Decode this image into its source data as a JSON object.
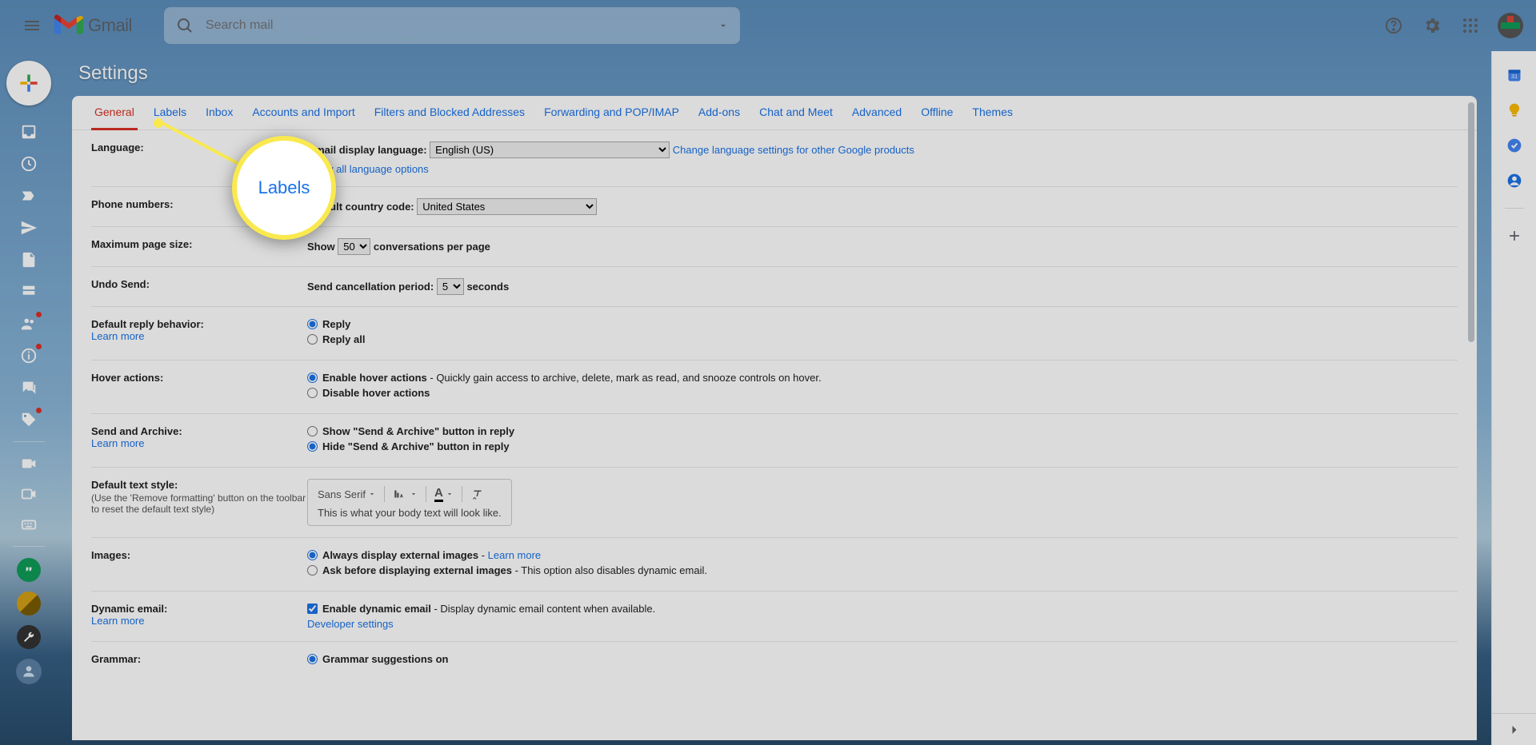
{
  "app": {
    "name": "Gmail"
  },
  "search": {
    "placeholder": "Search mail"
  },
  "page_title": "Settings",
  "tabs": [
    "General",
    "Labels",
    "Inbox",
    "Accounts and Import",
    "Filters and Blocked Addresses",
    "Forwarding and POP/IMAP",
    "Add-ons",
    "Chat and Meet",
    "Advanced",
    "Offline",
    "Themes"
  ],
  "active_tab": "General",
  "callout_label": "Labels",
  "settings": {
    "language": {
      "label": "Language:",
      "field_label": "Gmail display language:",
      "selected": "English (US)",
      "change_link": "Change language settings for other Google products",
      "show_all": "Show all language options"
    },
    "phone": {
      "label": "Phone numbers:",
      "field_label": "Default country code:",
      "selected": "United States"
    },
    "page_size": {
      "label": "Maximum page size:",
      "prefix": "Show",
      "value": "50",
      "suffix": "conversations per page"
    },
    "undo": {
      "label": "Undo Send:",
      "prefix": "Send cancellation period:",
      "value": "5",
      "suffix": "seconds"
    },
    "reply": {
      "label": "Default reply behavior:",
      "learn": "Learn more",
      "opt1": "Reply",
      "opt2": "Reply all"
    },
    "hover": {
      "label": "Hover actions:",
      "opt1": "Enable hover actions",
      "opt1_desc": " - Quickly gain access to archive, delete, mark as read, and snooze controls on hover.",
      "opt2": "Disable hover actions"
    },
    "archive": {
      "label": "Send and Archive:",
      "learn": "Learn more",
      "opt1": "Show \"Send & Archive\" button in reply",
      "opt2": "Hide \"Send & Archive\" button in reply"
    },
    "textstyle": {
      "label": "Default text style:",
      "sub": "(Use the 'Remove formatting' button on the toolbar to reset the default text style)",
      "font": "Sans Serif",
      "preview": "This is what your body text will look like."
    },
    "images": {
      "label": "Images:",
      "opt1": "Always display external images",
      "opt1_link": "Learn more",
      "opt2": "Ask before displaying external images",
      "opt2_desc": " - This option also disables dynamic email."
    },
    "dynamic": {
      "label": "Dynamic email:",
      "learn": "Learn more",
      "chk": "Enable dynamic email",
      "desc": " - Display dynamic email content when available.",
      "dev": "Developer settings"
    },
    "grammar": {
      "label": "Grammar:",
      "opt1": "Grammar suggestions on"
    }
  }
}
